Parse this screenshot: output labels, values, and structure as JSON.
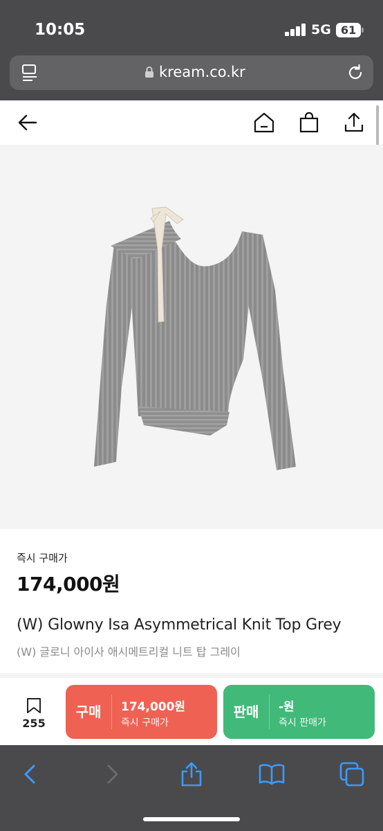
{
  "status_bar": {
    "time": "10:05",
    "network": "5G",
    "battery": "61"
  },
  "browser": {
    "url": "kream.co.kr",
    "icons": [
      "reader-mode-icon",
      "lock-icon",
      "reload-icon"
    ]
  },
  "page_nav": {
    "icons": [
      "back-arrow-icon",
      "home-icon",
      "shopping-bag-icon",
      "share-icon"
    ]
  },
  "product": {
    "image_alt": "grey asymmetrical ribbed knit top",
    "price_label": "즉시 구매가",
    "price": "174,000원",
    "title": "(W) Glowny Isa Asymmetrical Knit Top Grey",
    "subtitle": "(W) 글로니 아이사 애시메트리컬 니트 탑 그레이"
  },
  "action_bar": {
    "bookmark_count": "255",
    "buy": {
      "label": "구매",
      "price": "174,000원",
      "sub": "즉시 구매가",
      "color": "#ef6253"
    },
    "sell": {
      "label": "판매",
      "price": "-원",
      "sub": "즉시 판매가",
      "color": "#41b979"
    }
  },
  "safari_toolbar": {
    "icons": [
      "back-icon",
      "forward-icon",
      "share-icon",
      "bookmarks-icon",
      "tabs-icon"
    ]
  }
}
